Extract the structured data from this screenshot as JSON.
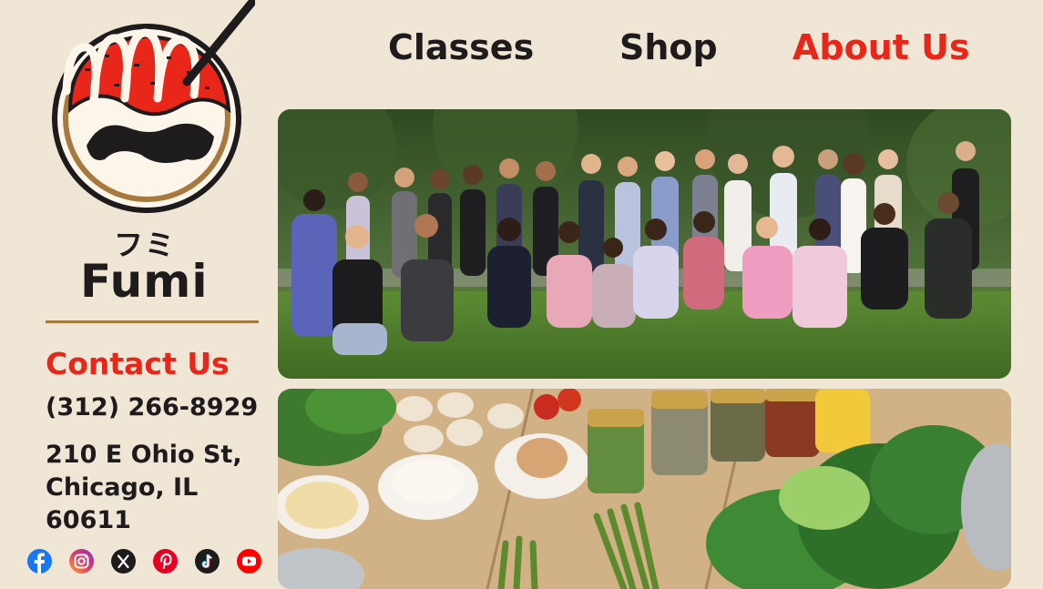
{
  "brand": {
    "kana": "フミ",
    "name": "Fumi"
  },
  "nav": {
    "classes": "Classes",
    "shop": "Shop",
    "about": "About Us",
    "active": "about",
    "active_color": "#e8261a"
  },
  "contact": {
    "title": "Contact Us",
    "phone": "(312) 266-8929",
    "address_line1": "210 E Ohio St,",
    "address_line2": "Chicago, IL",
    "address_line3": "60611"
  },
  "socials": [
    {
      "icon": "facebook-icon"
    },
    {
      "icon": "instagram-icon"
    },
    {
      "icon": "x-twitter-icon"
    },
    {
      "icon": "pinterest-icon"
    },
    {
      "icon": "tiktok-icon"
    },
    {
      "icon": "youtube-icon"
    }
  ],
  "photos": [
    {
      "subject": "group-photo-of-class-outdoors"
    },
    {
      "subject": "cooking-ingredients-table"
    }
  ],
  "colors": {
    "background": "#efe6d6",
    "accent": "#e8261a",
    "divider": "#a8793e",
    "text": "#1d1b1b"
  }
}
